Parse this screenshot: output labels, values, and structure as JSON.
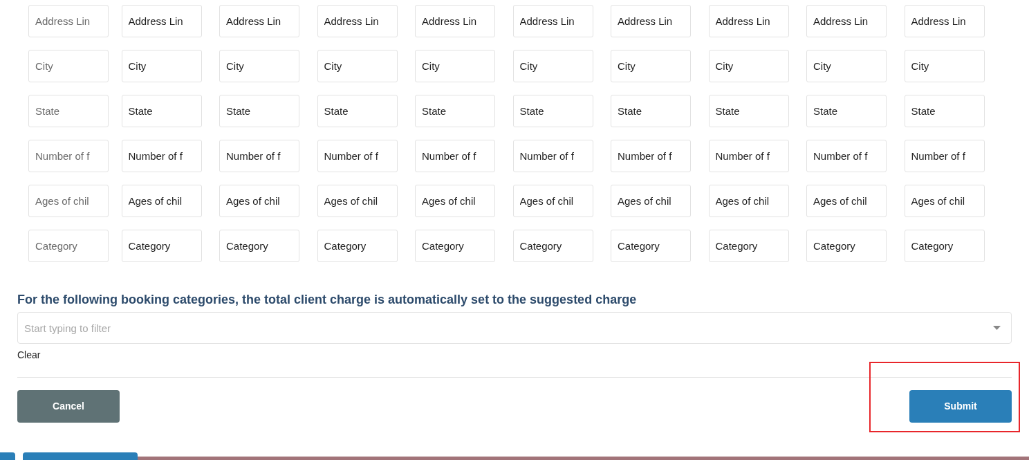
{
  "field_rows": [
    {
      "cells": [
        {
          "placeholder": "Address Lin"
        },
        {
          "value": "Address Lin"
        },
        {
          "value": "Address Lin"
        },
        {
          "value": "Address Lin"
        },
        {
          "value": "Address Lin"
        },
        {
          "value": "Address Lin"
        },
        {
          "value": "Address Lin"
        },
        {
          "value": "Address Lin"
        },
        {
          "value": "Address Lin"
        },
        {
          "value": "Address Lin"
        }
      ]
    },
    {
      "cells": [
        {
          "placeholder": "City"
        },
        {
          "value": "City"
        },
        {
          "value": "City"
        },
        {
          "value": "City"
        },
        {
          "value": "City"
        },
        {
          "value": "City"
        },
        {
          "value": "City"
        },
        {
          "value": "City"
        },
        {
          "value": "City"
        },
        {
          "value": "City"
        }
      ]
    },
    {
      "cells": [
        {
          "placeholder": "State"
        },
        {
          "value": "State"
        },
        {
          "value": "State"
        },
        {
          "value": "State"
        },
        {
          "value": "State"
        },
        {
          "value": "State"
        },
        {
          "value": "State"
        },
        {
          "value": "State"
        },
        {
          "value": "State"
        },
        {
          "value": "State"
        }
      ]
    },
    {
      "cells": [
        {
          "placeholder": "Number of f"
        },
        {
          "value": "Number of f"
        },
        {
          "value": "Number of f"
        },
        {
          "value": "Number of f"
        },
        {
          "value": "Number of f"
        },
        {
          "value": "Number of f"
        },
        {
          "value": "Number of f"
        },
        {
          "value": "Number of f"
        },
        {
          "value": "Number of f"
        },
        {
          "value": "Number of f"
        }
      ]
    },
    {
      "cells": [
        {
          "placeholder": "Ages of chil"
        },
        {
          "value": "Ages of chil"
        },
        {
          "value": "Ages of chil"
        },
        {
          "value": "Ages of chil"
        },
        {
          "value": "Ages of chil"
        },
        {
          "value": "Ages of chil"
        },
        {
          "value": "Ages of chil"
        },
        {
          "value": "Ages of chil"
        },
        {
          "value": "Ages of chil"
        },
        {
          "value": "Ages of chil"
        }
      ]
    },
    {
      "cells": [
        {
          "placeholder": "Category"
        },
        {
          "value": "Category"
        },
        {
          "value": "Category"
        },
        {
          "value": "Category"
        },
        {
          "value": "Category"
        },
        {
          "value": "Category"
        },
        {
          "value": "Category"
        },
        {
          "value": "Category"
        },
        {
          "value": "Category"
        },
        {
          "value": "Category"
        }
      ]
    }
  ],
  "booking_categories": {
    "heading": "For the following booking categories, the total client charge is automatically set to the suggested charge",
    "placeholder": "Start typing to filter",
    "clear_link": "Clear"
  },
  "buttons": {
    "cancel": "Cancel",
    "submit": "Submit"
  }
}
